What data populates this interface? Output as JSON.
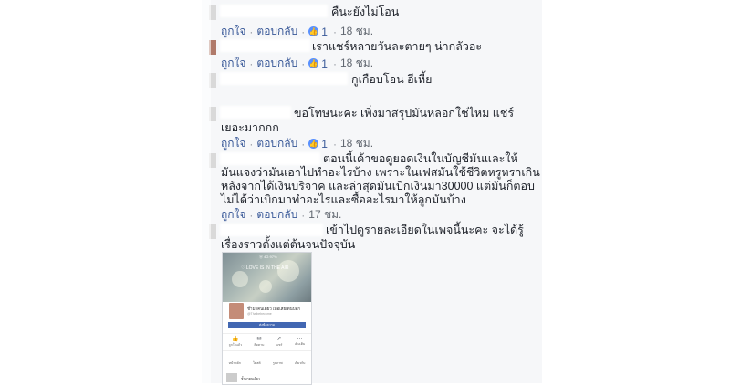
{
  "labels": {
    "like": "ถูกใจ",
    "reply": "ตอบกลับ",
    "dot": "·",
    "like_glyph": "👍"
  },
  "comments": [
    {
      "text": "คืนะยังไม่โอน",
      "likes": "1",
      "time": "18 ชม."
    },
    {
      "text": "เราแชร์หลายวันละตายๆ น่ากลัวอะ",
      "likes": "1",
      "time": "18 ชม."
    },
    {
      "text": "กูเกือบโอน อีเหี้ย",
      "likes": "",
      "time": ""
    },
    {
      "text_lines": [
        "ขอโทษนะคะ เพิ่งมาสรุปมันหลอกใช่ไหม แชร์",
        "เยอะมากกก"
      ],
      "likes": "1",
      "time": "18 ชม."
    },
    {
      "text_lines": [
        "ตอนนี้เค้าขอดูยอดเงินในบัญชีมันและให้",
        "มันแจงว่ามันเอาไปทำอะไรบ้าง เพราะในเฟสมันใช้ชีวิตหรูหราเกิน",
        "หลังจากได้เงินบริจาค และล่าสุดมันเบิกเงินมา30000 แต่มันก็ตอบ",
        "ไม่ได้ว่าเบิกมาทำอะไรและซื้ออะไรมาให้ลูกมันบ้าง"
      ],
      "likes": "",
      "time": "17 ชม."
    },
    {
      "text_lines": [
        "เข้าไปดูรายละเอียดในเพจนี้นะคะ จะได้รู้",
        "เรื่องราวตั้งแต่ต้นจนปัจจุบัน"
      ]
    }
  ],
  "screenshot": {
    "cover_title": "♡ LOVE IS IN THE AIR",
    "status": "Ⓐ 4G 97%",
    "page_name": "ช้ำมาคนเดียว เพื่อเสียเด่นบอก",
    "page_sub": "@Thaibebecome",
    "button": "ส่งข้อความ",
    "tabs": [
      {
        "glyph": "👍",
        "label": "ถูกใจแล้ว"
      },
      {
        "glyph": "✉",
        "label": "ติดตาม"
      },
      {
        "glyph": "↗",
        "label": "แชร์"
      },
      {
        "glyph": "…",
        "label": "เพิ่มเติม"
      }
    ],
    "row2": [
      "หน้าหลัก",
      "โพสต์",
      "รูปภาพ",
      "เกี่ยวกับ"
    ],
    "bottom_text": "ช้ำมาคนเดียว"
  }
}
